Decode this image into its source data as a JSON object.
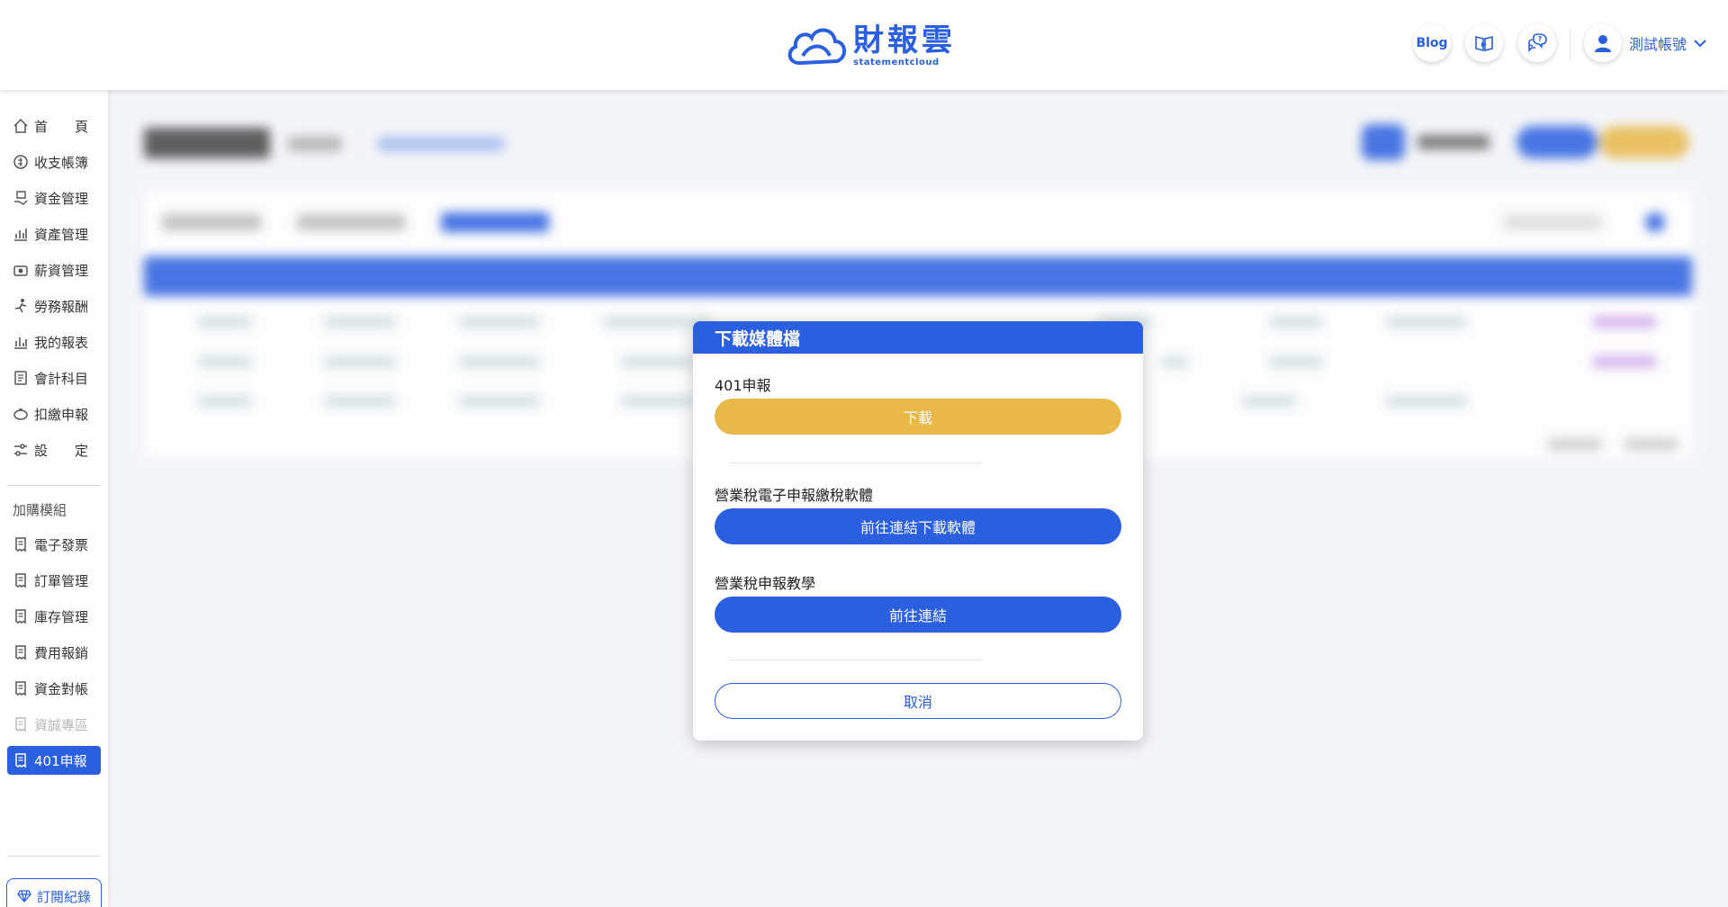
{
  "brand": {
    "name_cn": "財報雲",
    "name_en": "statementcloud"
  },
  "header": {
    "blog_label": "Blog",
    "account_label": "測試帳號"
  },
  "sidebar": {
    "items": [
      {
        "label": "首　　頁",
        "icon": "home-icon"
      },
      {
        "label": "收支帳簿",
        "icon": "coin-icon"
      },
      {
        "label": "資金管理",
        "icon": "money-hand-icon"
      },
      {
        "label": "資產管理",
        "icon": "bar-chart-icon"
      },
      {
        "label": "薪資管理",
        "icon": "payroll-icon"
      },
      {
        "label": "勞務報酬",
        "icon": "worker-icon"
      },
      {
        "label": "我的報表",
        "icon": "report-chart-icon"
      },
      {
        "label": "會計科目",
        "icon": "ledger-icon"
      },
      {
        "label": "扣繳申報",
        "icon": "piggy-bank-icon"
      },
      {
        "label": "設　　定",
        "icon": "settings-sliders-icon"
      }
    ],
    "addon_heading": "加購模組",
    "addons": [
      {
        "label": "電子發票",
        "icon": "receipt-icon",
        "state": "normal"
      },
      {
        "label": "訂單管理",
        "icon": "receipt-icon",
        "state": "normal"
      },
      {
        "label": "庫存管理",
        "icon": "receipt-icon",
        "state": "normal"
      },
      {
        "label": "費用報銷",
        "icon": "receipt-icon",
        "state": "normal"
      },
      {
        "label": "資金對帳",
        "icon": "receipt-icon",
        "state": "normal"
      },
      {
        "label": "資誠專區",
        "icon": "receipt-icon",
        "state": "disabled"
      },
      {
        "label": "401申報",
        "icon": "receipt-icon",
        "state": "active"
      }
    ],
    "subscription_label": "訂閱紀錄"
  },
  "modal": {
    "title": "下載媒體檔",
    "section1_label": "401申報",
    "download_button": "下載",
    "section2_label": "營業稅電子申報繳稅軟體",
    "software_button": "前往連結下載軟體",
    "section3_label": "營業稅申報教學",
    "link_button": "前往連結",
    "cancel_button": "取消"
  },
  "colors": {
    "primary": "#2a5fe0",
    "accent": "#e8b84a"
  }
}
